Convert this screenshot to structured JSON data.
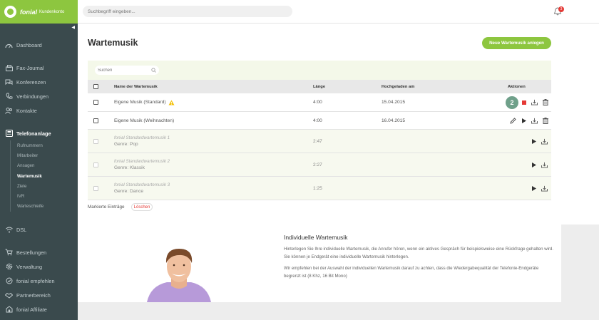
{
  "brand": {
    "name": "fonial",
    "sub": "Kundenkonto"
  },
  "topbar": {
    "search_placeholder": "Suchbegriff eingeben...",
    "notification_count": "3"
  },
  "sidebar": {
    "items": [
      {
        "label": "Dashboard",
        "icon": "dashboard-icon"
      },
      {
        "label": "Fax-Journal",
        "icon": "fax-icon"
      },
      {
        "label": "Konferenzen",
        "icon": "conference-icon"
      },
      {
        "label": "Verbindungen",
        "icon": "phone-icon"
      },
      {
        "label": "Kontakte",
        "icon": "contacts-icon"
      },
      {
        "label": "Telefonanlage",
        "icon": "telephone-system-icon"
      }
    ],
    "sub_items": [
      "Rufnummern",
      "Mitarbeiter",
      "Ansagen",
      "Wartemusik",
      "Ziele",
      "IVR",
      "Warteschleife"
    ],
    "bottom_items": [
      {
        "label": "DSL",
        "icon": "wifi-icon"
      },
      {
        "label": "Bestellungen",
        "icon": "cart-icon"
      },
      {
        "label": "Verwaltung",
        "icon": "settings-icon"
      },
      {
        "label": "fonial empfehlen",
        "icon": "recommend-icon"
      },
      {
        "label": "Partnerbereich",
        "icon": "partner-icon"
      },
      {
        "label": "fonial Affiliate",
        "icon": "affiliate-icon"
      }
    ]
  },
  "page": {
    "title": "Wartemusik",
    "new_button": "Neue Wartemusik anlegen",
    "search_placeholder": "Suchen"
  },
  "table": {
    "headers": {
      "name": "Name der Wartemusik",
      "length": "Länge",
      "uploaded": "Hochgeladen am",
      "actions": "Aktionen"
    },
    "rows": [
      {
        "name": "Eigene Musik (Standard)",
        "length": "4:00",
        "uploaded": "15.04.2015"
      },
      {
        "name": "Eigene Musik (Weihnachten)",
        "length": "4:00",
        "uploaded": "16.04.2015"
      },
      {
        "name": "fonial Standardwartemusik 1",
        "genre": "Genre: Pop",
        "length": "2:47"
      },
      {
        "name": "fonial Standardwartemusik 2",
        "genre": "Genre: Klassik",
        "length": "2:27"
      },
      {
        "name": "fonial Standardwartemusik 3",
        "genre": "Genre: Dance",
        "length": "1:25"
      }
    ],
    "step_badge": "2"
  },
  "footer": {
    "marked_label": "Markierte Einträge",
    "delete_label": "Löschen"
  },
  "info": {
    "title": "Individuelle Wartemusik",
    "p1": "Hinterlegen Sie Ihre individuelle Wartemusik, die Anrufer hören, wenn ein aktives Gespräch für beispielsweise eine Rückfrage gehalten wird. Sie können je Endgerät eine individuelle Wartemusik hinterlegen.",
    "p2": "Wir empfehlen bei der Auswahl der individuellen Wartemusik darauf zu achten, dass die Wiedergabequalität der Telefonie-Endgeräte begrenzt ist (8 Khz, 16 Bit Mono)"
  },
  "colors": {
    "accent": "#8dc63f",
    "sidebar": "#3a4a4d",
    "badge": "#6fa08a",
    "stop": "#e53935"
  }
}
